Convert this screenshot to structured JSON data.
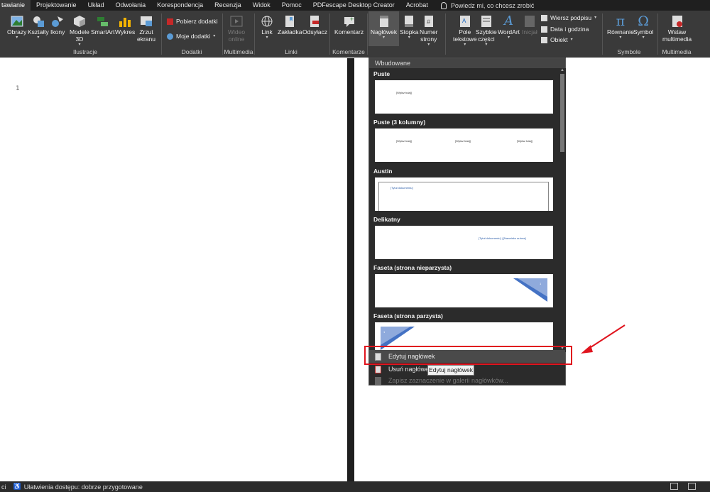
{
  "tabs": [
    "tawianie",
    "Projektowanie",
    "Układ",
    "Odwołania",
    "Korespondencja",
    "Recenzja",
    "Widok",
    "Pomoc",
    "PDFescape Desktop Creator",
    "Acrobat"
  ],
  "tellme": "Powiedz mi, co chcesz zrobić",
  "ribbon": {
    "ilustracje": {
      "obrazy": "Obrazy",
      "ksztalty": "Kształty",
      "ikony": "Ikony",
      "modele1": "Modele",
      "modele2": "3D",
      "smartart": "SmartArt",
      "wykres": "Wykres",
      "zrzut1": "Zrzut",
      "zrzut2": "ekranu",
      "label": "Ilustracje"
    },
    "dodatki": {
      "pobierz": "Pobierz dodatki",
      "moje": "Moje dodatki",
      "label": "Dodatki"
    },
    "multimedia": {
      "wideo1": "Wideo",
      "wideo2": "online",
      "label": "Multimedia"
    },
    "linki": {
      "link": "Link",
      "zakladka": "Zakładka",
      "odsylacz": "Odsyłacz",
      "label": "Linki"
    },
    "komentarze": {
      "komentarz": "Komentarz",
      "label": "Komentarze"
    },
    "naglowek": {
      "naglowek": "Nagłówek",
      "stopka": "Stopka",
      "numer1": "Numer",
      "numer2": "strony"
    },
    "tekst": {
      "pole1": "Pole",
      "pole2": "tekstowe",
      "szybkie1": "Szybkie",
      "szybkie2": "części",
      "wordart": "WordArt",
      "inicjal": "Inicjał",
      "wiersz": "Wiersz podpisu",
      "data": "Data i godzina",
      "obiekt": "Obiekt"
    },
    "symbole": {
      "rownanie": "Równanie",
      "symbol": "Symbol",
      "label": "Symbole"
    },
    "multimedia2": {
      "wstaw1": "Wstaw",
      "wstaw2": "multimedia",
      "label": "Multimedia"
    }
  },
  "document": {
    "line_number": "1"
  },
  "dropdown": {
    "header": "Wbudowane",
    "items": [
      {
        "title": "Puste",
        "ph": [
          "[Wpisz tutaj]"
        ]
      },
      {
        "title": "Puste (3 kolumny)",
        "ph": [
          "[Wpisz tutaj]",
          "[Wpisz tutaj]",
          "[Wpisz tutaj]"
        ]
      },
      {
        "title": "Austin",
        "ph": [
          "[Tytuł dokumentu]"
        ]
      },
      {
        "title": "Delikatny",
        "ph": [
          "[Tytuł dokumentu] | [Nazwisko autora]"
        ]
      },
      {
        "title": "Faseta (strona nieparzysta)",
        "ph": [
          "1"
        ]
      },
      {
        "title": "Faseta (strona parzysta)",
        "ph": [
          "1"
        ]
      }
    ],
    "menu": {
      "edit": "Edytuj nagłówek",
      "remove": "Usuń nagłówek",
      "save": "Zapisz zaznaczenie w galerii nagłówków..."
    }
  },
  "tooltip": "Edytuj nagłówek",
  "status": {
    "left": "ci",
    "accessibility": "Ułatwienia dostępu: dobrze przygotowane"
  },
  "colors": {
    "accent_red": "#e0141e",
    "ribbon_bg": "#3a3a3a",
    "tabs_bg": "#1f1f1f"
  }
}
